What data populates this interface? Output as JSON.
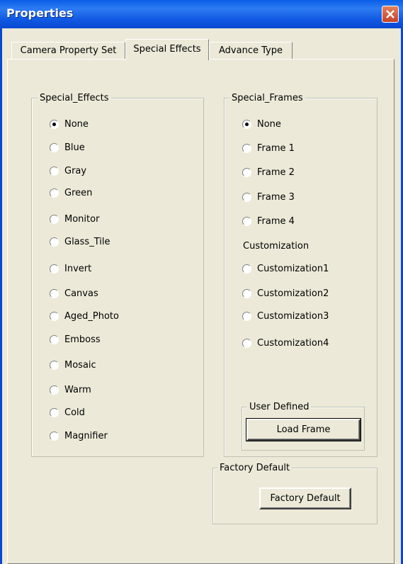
{
  "window": {
    "title": "Properties"
  },
  "tabs": [
    {
      "label": "Camera Property Set"
    },
    {
      "label": "Special Effects"
    },
    {
      "label": "Advance Type"
    }
  ],
  "special_effects": {
    "legend": "Special_Effects",
    "selected": "None",
    "options": [
      "None",
      "Blue",
      "Gray",
      "Green",
      "Monitor",
      "Glass_Tile",
      "Invert",
      "Canvas",
      "Aged_Photo",
      "Emboss",
      "Mosaic",
      "Warm",
      "Cold",
      "Magnifier"
    ]
  },
  "special_frames": {
    "legend": "Special_Frames",
    "selected": "None",
    "options": [
      "None",
      "Frame 1",
      "Frame 2",
      "Frame 3",
      "Frame 4"
    ],
    "customization_label": "Customization",
    "customization_options": [
      "Customization1",
      "Customization2",
      "Customization3",
      "Customization4"
    ]
  },
  "user_defined": {
    "legend": "User Defined",
    "button_label": "Load Frame"
  },
  "factory_default": {
    "legend": "Factory Default",
    "button_label": "Factory Default"
  },
  "colors": {
    "titlebar": "#0a5ee6",
    "dialog_bg": "#ece9d8",
    "close_button": "#c6412a"
  },
  "icons": {
    "close": "close-x-icon",
    "radio": "radio-button-icon"
  }
}
